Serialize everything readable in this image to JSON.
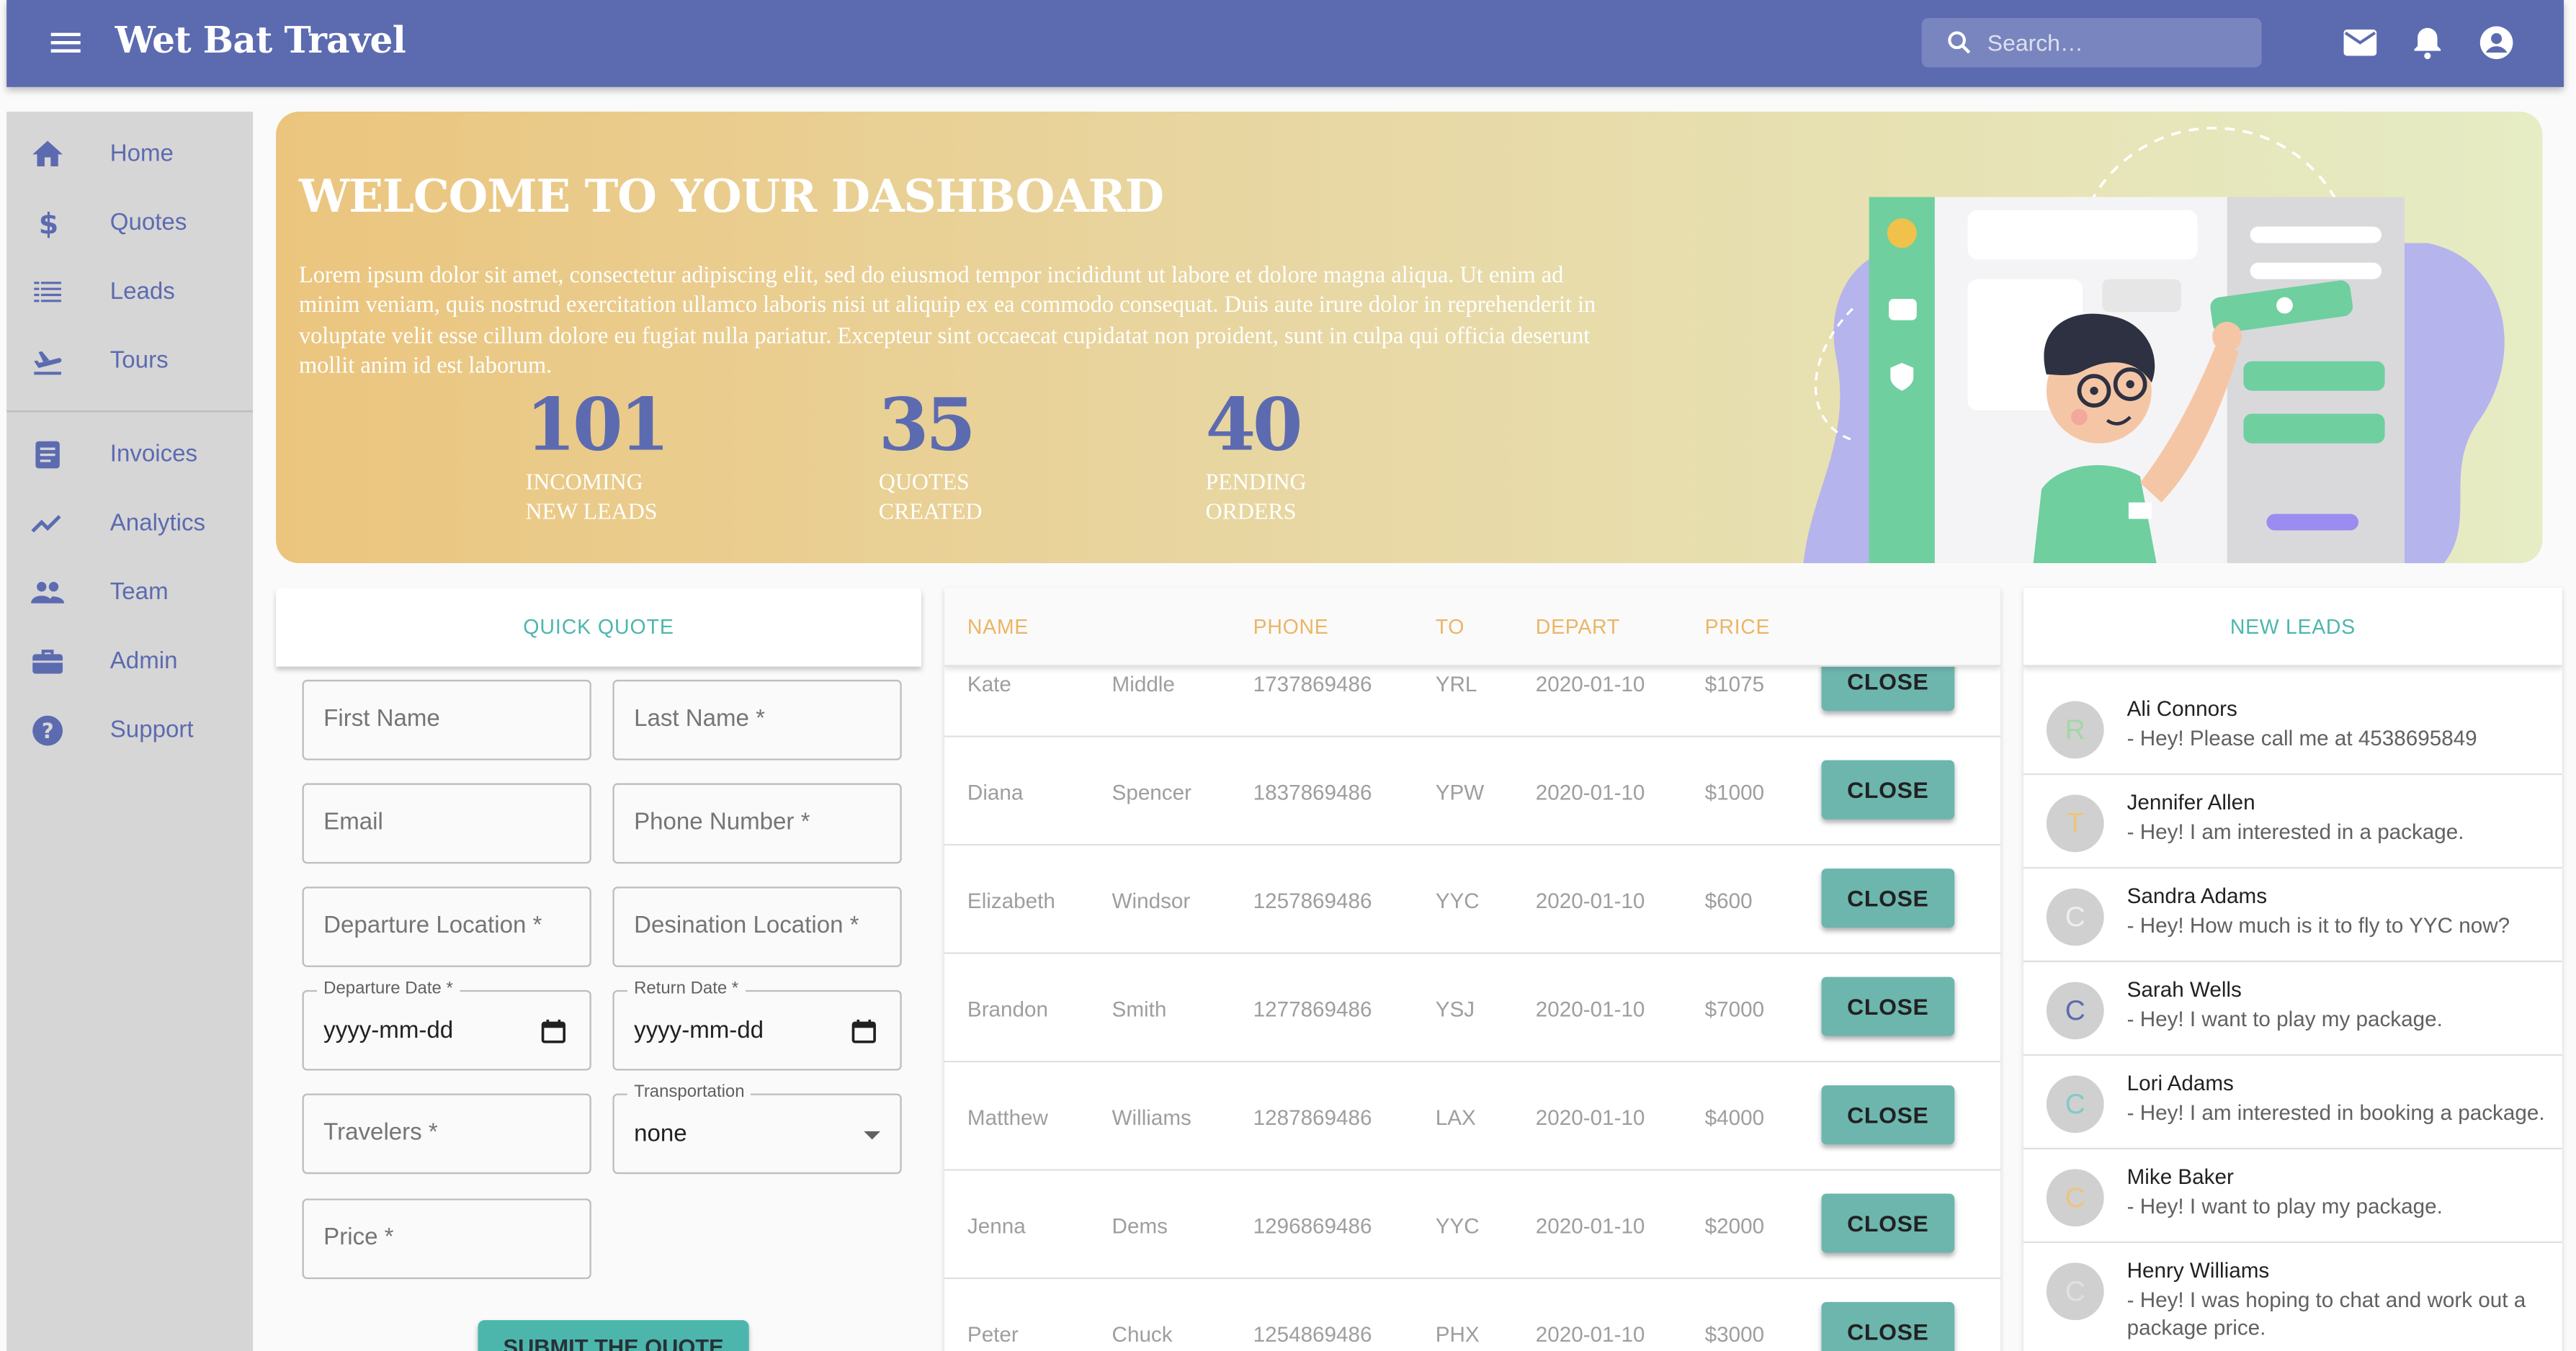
{
  "app": {
    "title": "Wet Bat Travel",
    "search_placeholder": "Search…",
    "accent": "#5c6bb0"
  },
  "sidebar": {
    "items": [
      {
        "label": "Home",
        "icon": "home-icon"
      },
      {
        "label": "Quotes",
        "icon": "dollar-icon"
      },
      {
        "label": "Leads",
        "icon": "list-icon"
      },
      {
        "label": "Tours",
        "icon": "flight-icon"
      },
      {
        "label": "Invoices",
        "icon": "document-icon"
      },
      {
        "label": "Analytics",
        "icon": "trending-icon"
      },
      {
        "label": "Team",
        "icon": "people-icon"
      },
      {
        "label": "Admin",
        "icon": "briefcase-icon"
      },
      {
        "label": "Support",
        "icon": "help-icon"
      }
    ]
  },
  "banner": {
    "title": "WELCOME TO YOUR DASHBOARD",
    "text": "Lorem ipsum dolor sit amet, consectetur adipiscing elit, sed do eiusmod tempor incididunt ut labore et dolore magna aliqua. Ut enim ad minim veniam, quis nostrud exercitation ullamco laboris nisi ut aliquip ex ea commodo consequat. Duis aute irure dolor in reprehenderit in voluptate velit esse cillum dolore eu fugiat nulla pariatur. Excepteur sint occaecat cupidatat non proident, sunt in culpa qui officia deserunt mollit anim id est laborum.",
    "stats": [
      {
        "value": "101",
        "line1": "INCOMING",
        "line2": "NEW LEADS"
      },
      {
        "value": "35",
        "line1": "QUOTES",
        "line2": "CREATED"
      },
      {
        "value": "40",
        "line1": "PENDING",
        "line2": "ORDERS"
      }
    ]
  },
  "quick_quote": {
    "title": "QUICK QUOTE",
    "first_name": "First Name",
    "last_name": "Last Name *",
    "email": "Email",
    "phone": "Phone Number *",
    "departure_location": "Departure Location *",
    "destination_location": "Desination Location *",
    "departure_date_label": "Departure Date *",
    "departure_date_value": "yyyy-mm-dd",
    "return_date_label": "Return Date *",
    "return_date_value": "yyyy-mm-dd",
    "travelers": "Travelers *",
    "transportation_label": "Transportation",
    "transportation_value": "none",
    "price": "Price *",
    "submit": "SUBMIT THE QUOTE"
  },
  "leads_table": {
    "headers": [
      "NAME",
      "PHONE",
      "TO",
      "DEPART",
      "PRICE"
    ],
    "close_label": "CLOSE",
    "rows": [
      {
        "first": "Kate",
        "last": "Middle",
        "phone": "1737869486",
        "to": "YRL",
        "depart": "2020-01-10",
        "price": "$1075"
      },
      {
        "first": "Diana",
        "last": "Spencer",
        "phone": "1837869486",
        "to": "YPW",
        "depart": "2020-01-10",
        "price": "$1000"
      },
      {
        "first": "Elizabeth",
        "last": "Windsor",
        "phone": "1257869486",
        "to": "YYC",
        "depart": "2020-01-10",
        "price": "$600"
      },
      {
        "first": "Brandon",
        "last": "Smith",
        "phone": "1277869486",
        "to": "YSJ",
        "depart": "2020-01-10",
        "price": "$7000"
      },
      {
        "first": "Matthew",
        "last": "Williams",
        "phone": "1287869486",
        "to": "LAX",
        "depart": "2020-01-10",
        "price": "$4000"
      },
      {
        "first": "Jenna",
        "last": "Dems",
        "phone": "1296869486",
        "to": "YYC",
        "depart": "2020-01-10",
        "price": "$2000"
      },
      {
        "first": "Peter",
        "last": "Chuck",
        "phone": "1254869486",
        "to": "PHX",
        "depart": "2020-01-10",
        "price": "$3000"
      }
    ]
  },
  "new_leads": {
    "title": "NEW LEADS",
    "items": [
      {
        "initial": "R",
        "initial_color": "#a5d6a7",
        "name": "Ali Connors",
        "message": "- Hey! Please call me at 4538695849"
      },
      {
        "initial": "T",
        "initial_color": "#ebc57e",
        "name": "Jennifer Allen",
        "message": "- Hey! I am interested in a package."
      },
      {
        "initial": "C",
        "initial_color": "#eeeeee",
        "name": "Sandra Adams",
        "message": "- Hey! How much is it to fly to YYC now?"
      },
      {
        "initial": "C",
        "initial_color": "#5c6bb0",
        "name": "Sarah Wells",
        "message": "- Hey! I want to play my package."
      },
      {
        "initial": "C",
        "initial_color": "#80cbc4",
        "name": "Lori Adams",
        "message": "- Hey! I am interested in booking a package."
      },
      {
        "initial": "C",
        "initial_color": "#ebc57e",
        "name": "Mike Baker",
        "message": "- Hey! I want to play my package."
      },
      {
        "initial": "C",
        "initial_color": "#e0e0e0",
        "name": "Henry Williams",
        "message": "- Hey! I was hoping to chat and work out a package price."
      }
    ]
  }
}
